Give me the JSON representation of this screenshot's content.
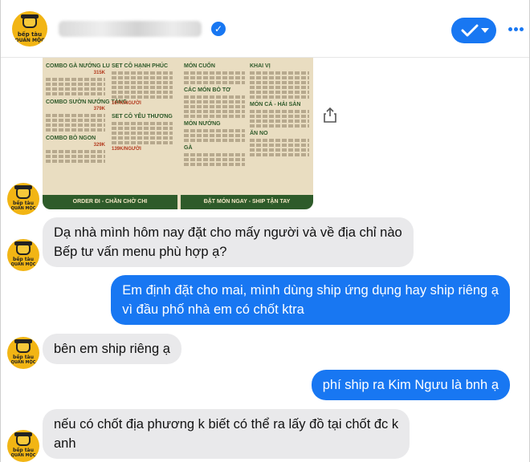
{
  "header": {
    "brand_line1": "bếp tàu",
    "brand_line2": "QUÁN MỘC"
  },
  "menu_image": {
    "sections": [
      {
        "title": "COMBO GÀ NƯỚNG LU",
        "price": "315K"
      },
      {
        "title": "COMBO SƯỜN NƯỚNG TẢNG",
        "price": "379K"
      },
      {
        "title": "COMBO BÒ NGON",
        "price": "329K"
      },
      {
        "title": "SET CÔ HẠNH PHÚC",
        "price": "167K/NGƯỜI"
      },
      {
        "title": "SET CÔ YÊU THƯƠNG",
        "price": "139K/NGƯỜI"
      },
      {
        "title": "MÓN CUỐN",
        "price": ""
      },
      {
        "title": "CÁC MÓN BÒ TƠ",
        "price": ""
      },
      {
        "title": "MÓN NƯỚNG",
        "price": ""
      },
      {
        "title": "GÀ",
        "price": ""
      },
      {
        "title": "KHAI VỊ",
        "price": ""
      },
      {
        "title": "MÓN CÁ - HẢI SẢN",
        "price": ""
      },
      {
        "title": "ĂN NO",
        "price": ""
      }
    ],
    "footer_left": "ORDER ĐI - CHẦN CHỜ CHI",
    "footer_right": "ĐẶT MÓN NGAY - SHIP TẬN TAY"
  },
  "messages": [
    {
      "from": "page",
      "lines": [
        "Dạ nhà mình hôm nay đặt cho mấy người và về địa chỉ nào",
        "Bếp tư vấn menu phù hợp ạ?"
      ]
    },
    {
      "from": "user",
      "lines": [
        "Em định đặt cho mai, mình dùng ship ứng dụng hay ship riêng ạ",
        "vì đầu phố nhà em có chốt ktra"
      ]
    },
    {
      "from": "page",
      "lines": [
        "bên em ship riêng ạ"
      ]
    },
    {
      "from": "user",
      "lines": [
        "phí ship ra Kim Ngưu là bnh ạ"
      ]
    },
    {
      "from": "page",
      "lines": [
        "nếu có chốt địa phương k biết có thể ra lấy đồ tại chốt đc k",
        "anh"
      ]
    }
  ],
  "colors": {
    "accent": "#1877f2",
    "incoming_bubble": "#e9e9eb",
    "logo": "#f2b514",
    "menu_green": "#2e5b2a"
  },
  "icons": [
    "verified-icon",
    "checkmark-icon",
    "more-icon",
    "share-icon"
  ]
}
